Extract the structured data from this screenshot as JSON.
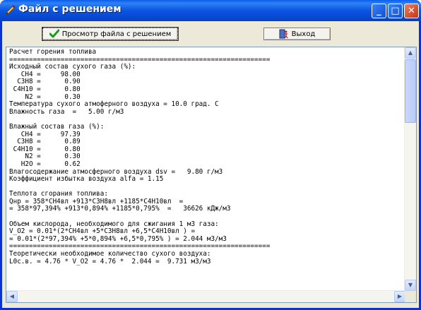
{
  "window": {
    "title": "Файл с решением",
    "controls": {
      "minimize": "_",
      "maximize": "□",
      "close": "✕"
    }
  },
  "toolbar": {
    "view_label": "Просмотр файла с решением",
    "view_icon": "green-checkmark-icon",
    "exit_label": "Выход",
    "exit_icon": "exit-door-icon"
  },
  "content": {
    "lines": [
      "Расчет горения топлива",
      "==================================================================",
      "Исходный состав сухого газа (%):",
      "   CH4 =     98.00",
      "  C3H8 =      0.90",
      " C4H10 =      0.80",
      "    N2 =      0.30",
      "Температура сухого атмоферного воздуха = 10.0 град. С",
      "Влажность газа  =   5.00 г/м3",
      "",
      "Влажный состав газа (%):",
      "   CH4 =     97.39",
      "  C3H8 =      0.89",
      " C4H10 =      0.80",
      "    N2 =      0.30",
      "   H2O =      0.62",
      "Влагосодержание атмосферного воздуха dsv =   9.80 г/м3",
      "Коэффициент избытка воздуха alfa = 1.15",
      "",
      "Теплота сгорания топлива:",
      "Qнр = 358*CH4вл +913*C3H8вл +1185*C4H10вл  =",
      "= 358*97,394% +913*0,894% +1185*0,795%  =   36626 кДж/м3",
      "",
      "Объем кислорода, необходимого для сжигания 1 м3 газа:",
      "V_O2 = 0.01*(2*CH4вл +5*C3H8вл +6,5*C4H10вл ) =",
      "= 0.01*(2*97,394% +5*0,894% +6,5*0,795% ) = 2.044 м3/м3",
      "==================================================================",
      "Теоретически необходимое количество сухого воздуха:",
      "L0с.в. = 4.76 * V_O2 = 4.76 *  2.044 =  9.731 м3/м3"
    ]
  },
  "colors": {
    "titlebar": "#0a55e0",
    "window_bg": "#ece9d8",
    "close_button": "#d6522f"
  }
}
